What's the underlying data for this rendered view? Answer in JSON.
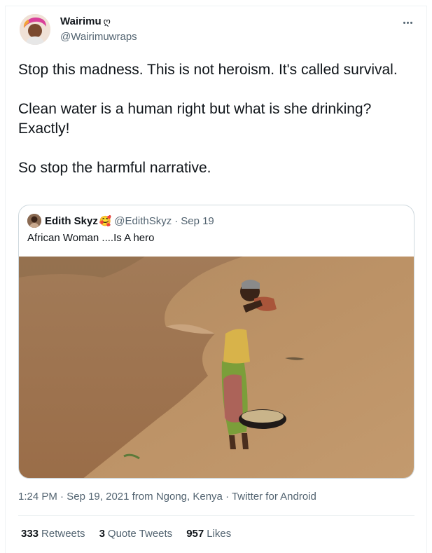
{
  "author": {
    "display_name": "Wairimu",
    "name_glyph": "ღ",
    "handle": "@Wairimuwraps",
    "avatar_icon": "user-avatar"
  },
  "tweet": {
    "paragraphs": [
      "Stop this madness. This is not heroism. It's called survival.",
      "Clean water is a human right but what is she drinking? Exactly!",
      "So stop the harmful narrative."
    ]
  },
  "quoted": {
    "display_name": "Edith Skyz",
    "emoji": "🥰",
    "handle": "@EdithSkyz",
    "separator": "·",
    "date": "Sep 19",
    "text": "African Woman ....Is A hero"
  },
  "meta": {
    "time": "1:24 PM",
    "dot1": "·",
    "date": "Sep 19, 2021",
    "from_text": "from",
    "location": "Ngong, Kenya",
    "dot2": "·",
    "source": "Twitter for Android"
  },
  "stats": {
    "retweets_count": "333",
    "retweets_label": "Retweets",
    "quotes_count": "3",
    "quotes_label": "Quote Tweets",
    "likes_count": "957",
    "likes_label": "Likes"
  },
  "colors": {
    "primary_text": "#0f1419",
    "secondary_text": "#536471",
    "border": "#cfd9de",
    "divider": "#eff3f4"
  }
}
